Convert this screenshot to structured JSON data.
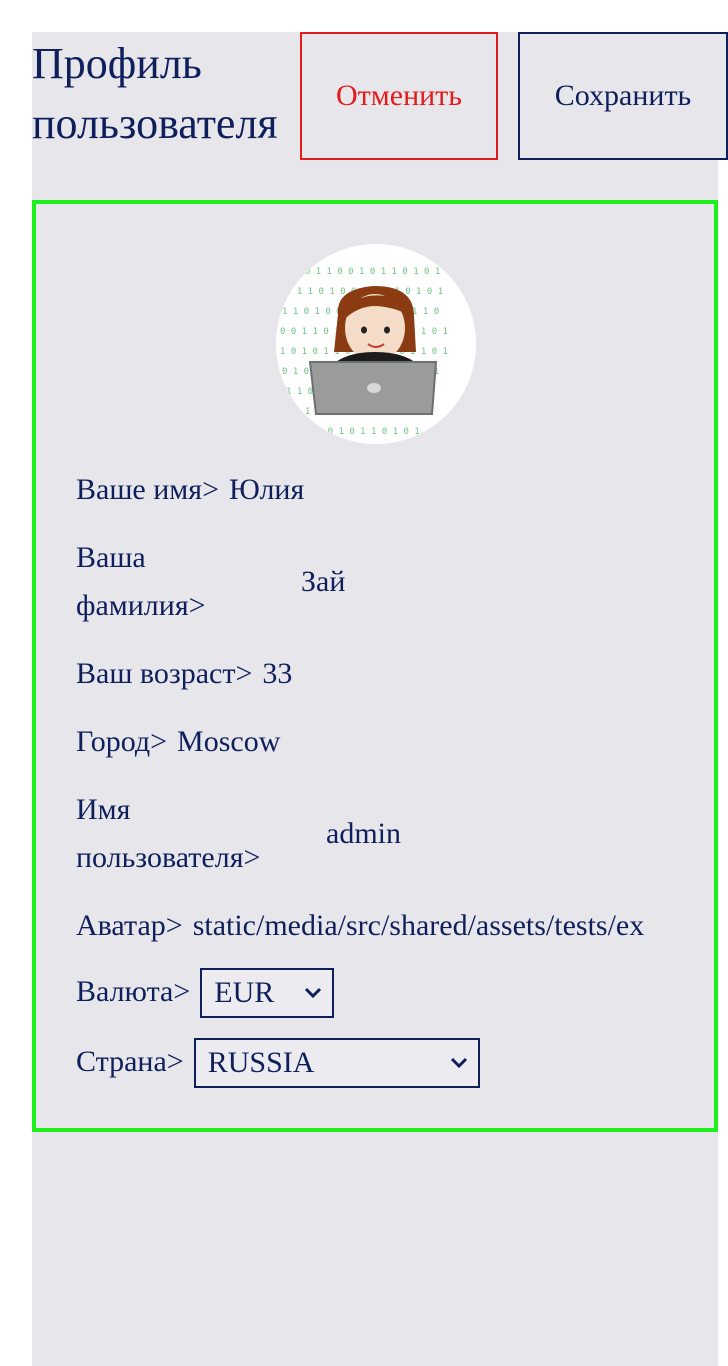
{
  "header": {
    "title": "Профиль\nпользователя",
    "cancel_label": "Отменить",
    "save_label": "Сохранить"
  },
  "profile": {
    "name_label": "Ваше имя>",
    "name_value": "Юлия",
    "surname_label": "Ваша\nфамилия>",
    "surname_value": "Зай",
    "age_label": "Ваш возраст>",
    "age_value": "33",
    "city_label": "Город>",
    "city_value": "Moscow",
    "username_label": "Имя\nпользователя>",
    "username_value": "admin",
    "avatar_label": "Аватар>",
    "avatar_value": "static/media/src/shared/assets/tests/ex",
    "currency_label": "Валюта>",
    "currency_selected": "EUR",
    "country_label": "Страна>",
    "country_selected": "RUSSIA"
  },
  "colors": {
    "text": "#0f1f5c",
    "cancel": "#e31b1b",
    "card_border": "#1ef01e",
    "panel": "#e7e7eb"
  },
  "icons": {
    "avatar": "woman-with-laptop-avatar",
    "select_arrow": "chevron-down-icon"
  }
}
